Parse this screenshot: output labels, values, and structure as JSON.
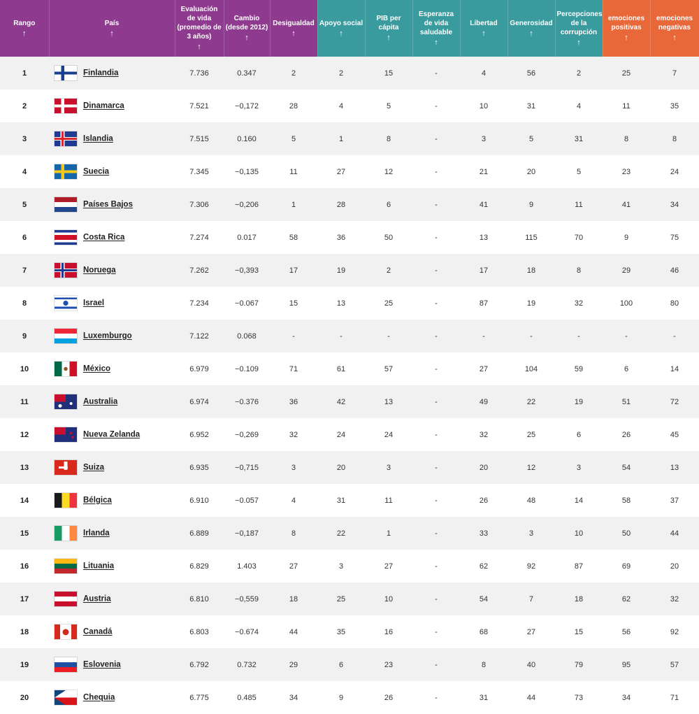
{
  "headers": [
    {
      "label": "Rango",
      "group": "purple"
    },
    {
      "label": "País",
      "group": "purple"
    },
    {
      "label": "Evaluación de vida (promedio de 3 años)",
      "group": "purple"
    },
    {
      "label": "Cambio (desde 2012)",
      "group": "purple"
    },
    {
      "label": "Desigualdad",
      "group": "purple"
    },
    {
      "label": "Apoyo social",
      "group": "teal"
    },
    {
      "label": "PIB per cápita",
      "group": "teal"
    },
    {
      "label": "Esperanza de vida saludable",
      "group": "teal"
    },
    {
      "label": "Libertad",
      "group": "teal"
    },
    {
      "label": "Generosidad",
      "group": "teal"
    },
    {
      "label": "Percepciones de la corrupción",
      "group": "teal"
    },
    {
      "label": "emociones positivas",
      "group": "orange"
    },
    {
      "label": "emociones negativas",
      "group": "orange"
    }
  ],
  "sort_glyph": "↑",
  "group_colors": {
    "purple": "#8e3a8f",
    "teal": "#3a9b9e",
    "orange": "#e8683a"
  },
  "rows": [
    {
      "rank": "1",
      "country": "Finlandia",
      "flag": "finland",
      "life": "7.736",
      "change": "0.347",
      "inequality": "2",
      "social": "2",
      "gdp": "15",
      "health": "-",
      "freedom": "4",
      "generosity": "56",
      "corruption": "2",
      "pos": "25",
      "neg": "7"
    },
    {
      "rank": "2",
      "country": "Dinamarca",
      "flag": "denmark",
      "life": "7.521",
      "change": "−0,172",
      "inequality": "28",
      "social": "4",
      "gdp": "5",
      "health": "-",
      "freedom": "10",
      "generosity": "31",
      "corruption": "4",
      "pos": "11",
      "neg": "35"
    },
    {
      "rank": "3",
      "country": "Islandia",
      "flag": "iceland",
      "life": "7.515",
      "change": "0.160",
      "inequality": "5",
      "social": "1",
      "gdp": "8",
      "health": "-",
      "freedom": "3",
      "generosity": "5",
      "corruption": "31",
      "pos": "8",
      "neg": "8"
    },
    {
      "rank": "4",
      "country": "Suecia",
      "flag": "sweden",
      "life": "7.345",
      "change": "−0,135",
      "inequality": "11",
      "social": "27",
      "gdp": "12",
      "health": "-",
      "freedom": "21",
      "generosity": "20",
      "corruption": "5",
      "pos": "23",
      "neg": "24"
    },
    {
      "rank": "5",
      "country": "Países Bajos",
      "flag": "netherlands",
      "life": "7.306",
      "change": "−0,206",
      "inequality": "1",
      "social": "28",
      "gdp": "6",
      "health": "-",
      "freedom": "41",
      "generosity": "9",
      "corruption": "11",
      "pos": "41",
      "neg": "34"
    },
    {
      "rank": "6",
      "country": "Costa Rica",
      "flag": "costarica",
      "life": "7.274",
      "change": "0.017",
      "inequality": "58",
      "social": "36",
      "gdp": "50",
      "health": "-",
      "freedom": "13",
      "generosity": "115",
      "corruption": "70",
      "pos": "9",
      "neg": "75"
    },
    {
      "rank": "7",
      "country": "Noruega",
      "flag": "norway",
      "life": "7.262",
      "change": "−0,393",
      "inequality": "17",
      "social": "19",
      "gdp": "2",
      "health": "-",
      "freedom": "17",
      "generosity": "18",
      "corruption": "8",
      "pos": "29",
      "neg": "46"
    },
    {
      "rank": "8",
      "country": "Israel",
      "flag": "israel",
      "life": "7.234",
      "change": "−0.067",
      "inequality": "15",
      "social": "13",
      "gdp": "25",
      "health": "-",
      "freedom": "87",
      "generosity": "19",
      "corruption": "32",
      "pos": "100",
      "neg": "80"
    },
    {
      "rank": "9",
      "country": "Luxemburgo",
      "flag": "luxembourg",
      "life": "7.122",
      "change": "0.068",
      "inequality": "-",
      "social": "-",
      "gdp": "-",
      "health": "-",
      "freedom": "-",
      "generosity": "-",
      "corruption": "-",
      "pos": "-",
      "neg": "-"
    },
    {
      "rank": "10",
      "country": "México",
      "flag": "mexico",
      "life": "6.979",
      "change": "−0.109",
      "inequality": "71",
      "social": "61",
      "gdp": "57",
      "health": "-",
      "freedom": "27",
      "generosity": "104",
      "corruption": "59",
      "pos": "6",
      "neg": "14"
    },
    {
      "rank": "11",
      "country": "Australia",
      "flag": "australia",
      "life": "6.974",
      "change": "−0.376",
      "inequality": "36",
      "social": "42",
      "gdp": "13",
      "health": "-",
      "freedom": "49",
      "generosity": "22",
      "corruption": "19",
      "pos": "51",
      "neg": "72"
    },
    {
      "rank": "12",
      "country": "Nueva Zelanda",
      "flag": "newzealand",
      "life": "6.952",
      "change": "−0,269",
      "inequality": "32",
      "social": "24",
      "gdp": "24",
      "health": "-",
      "freedom": "32",
      "generosity": "25",
      "corruption": "6",
      "pos": "26",
      "neg": "45"
    },
    {
      "rank": "13",
      "country": "Suiza",
      "flag": "switzerland",
      "life": "6.935",
      "change": "−0,715",
      "inequality": "3",
      "social": "20",
      "gdp": "3",
      "health": "-",
      "freedom": "20",
      "generosity": "12",
      "corruption": "3",
      "pos": "54",
      "neg": "13"
    },
    {
      "rank": "14",
      "country": "Bélgica",
      "flag": "belgium",
      "life": "6.910",
      "change": "−0.057",
      "inequality": "4",
      "social": "31",
      "gdp": "11",
      "health": "-",
      "freedom": "26",
      "generosity": "48",
      "corruption": "14",
      "pos": "58",
      "neg": "37"
    },
    {
      "rank": "15",
      "country": "Irlanda",
      "flag": "ireland",
      "life": "6.889",
      "change": "−0,187",
      "inequality": "8",
      "social": "22",
      "gdp": "1",
      "health": "-",
      "freedom": "33",
      "generosity": "3",
      "corruption": "10",
      "pos": "50",
      "neg": "44"
    },
    {
      "rank": "16",
      "country": "Lituania",
      "flag": "lithuania",
      "life": "6.829",
      "change": "1.403",
      "inequality": "27",
      "social": "3",
      "gdp": "27",
      "health": "-",
      "freedom": "62",
      "generosity": "92",
      "corruption": "87",
      "pos": "69",
      "neg": "20"
    },
    {
      "rank": "17",
      "country": "Austria",
      "flag": "austria",
      "life": "6.810",
      "change": "−0,559",
      "inequality": "18",
      "social": "25",
      "gdp": "10",
      "health": "-",
      "freedom": "54",
      "generosity": "7",
      "corruption": "18",
      "pos": "62",
      "neg": "32"
    },
    {
      "rank": "18",
      "country": "Canadá",
      "flag": "canada",
      "life": "6.803",
      "change": "−0.674",
      "inequality": "44",
      "social": "35",
      "gdp": "16",
      "health": "-",
      "freedom": "68",
      "generosity": "27",
      "corruption": "15",
      "pos": "56",
      "neg": "92"
    },
    {
      "rank": "19",
      "country": "Eslovenia",
      "flag": "slovenia",
      "life": "6.792",
      "change": "0.732",
      "inequality": "29",
      "social": "6",
      "gdp": "23",
      "health": "-",
      "freedom": "8",
      "generosity": "40",
      "corruption": "79",
      "pos": "95",
      "neg": "57"
    },
    {
      "rank": "20",
      "country": "Chequia",
      "flag": "czechia",
      "life": "6.775",
      "change": "0.485",
      "inequality": "34",
      "social": "9",
      "gdp": "26",
      "health": "-",
      "freedom": "31",
      "generosity": "44",
      "corruption": "73",
      "pos": "34",
      "neg": "71"
    }
  ]
}
